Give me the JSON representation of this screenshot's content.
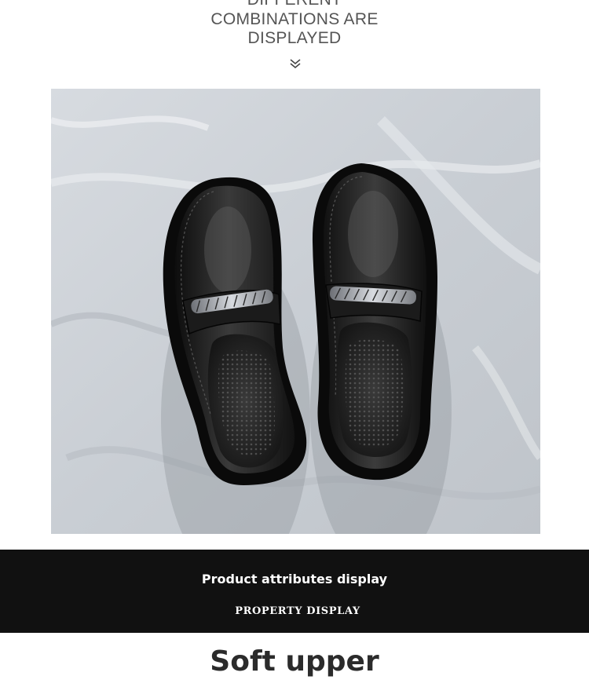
{
  "header": {
    "lines": [
      "DIFFERENT",
      "COMBINATIONS ARE",
      "DISPLAYED"
    ],
    "icon": "double-chevron-down-icon"
  },
  "photo": {
    "subject": "pair of black leather chain loafers on white fabric"
  },
  "banner": {
    "title": "Product attributes display",
    "subtitle": "PROPERTY DISPLAY",
    "background": "#111111"
  },
  "section": {
    "title": "Soft upper"
  }
}
